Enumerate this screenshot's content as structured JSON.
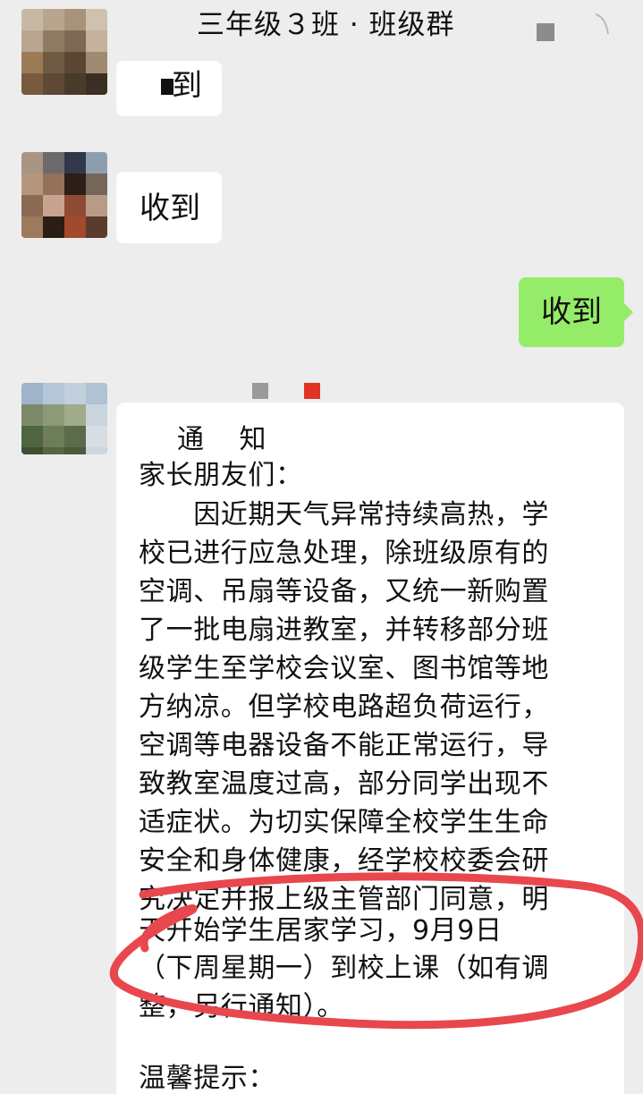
{
  "header": {
    "title": "三年级３班 · 班级群",
    "back_icon": "chevron-left-icon",
    "menu_icon": "more-icon"
  },
  "messages": [
    {
      "sender": "other",
      "text": "到"
    },
    {
      "sender": "other",
      "text": "收到"
    },
    {
      "sender": "me",
      "text": "收到"
    }
  ],
  "notice": {
    "title": "通　 知",
    "greeting": "家长朋友们：",
    "body_lines": [
      "　　因近期天气异常持续高热，学",
      "校已进行应急处理，除班级原有的",
      "空调、吊扇等设备，又统一新购置",
      "了一批电扇进教室，并转移部分班",
      "级学生至学校会议室、图书馆等地",
      "方纳凉。但学校电路超负荷运行，",
      "空调等电器设备不能正常运行，导",
      "致教室温度过高，部分同学出现不",
      "适症状。为切实保障全校学生生命",
      "安全和身体健康，经学校校委会研",
      "究决定并报上级主管部门同意，明",
      "天开始学生居家学习，9月9日",
      "（下周星期一）到校上课（如有调",
      "整，另行通知）。"
    ],
    "tip": "温馨提示："
  },
  "colors": {
    "background": "#ededed",
    "bubble_other": "#ffffff",
    "bubble_mine": "#95ec69",
    "annotation": "#e8474d"
  }
}
